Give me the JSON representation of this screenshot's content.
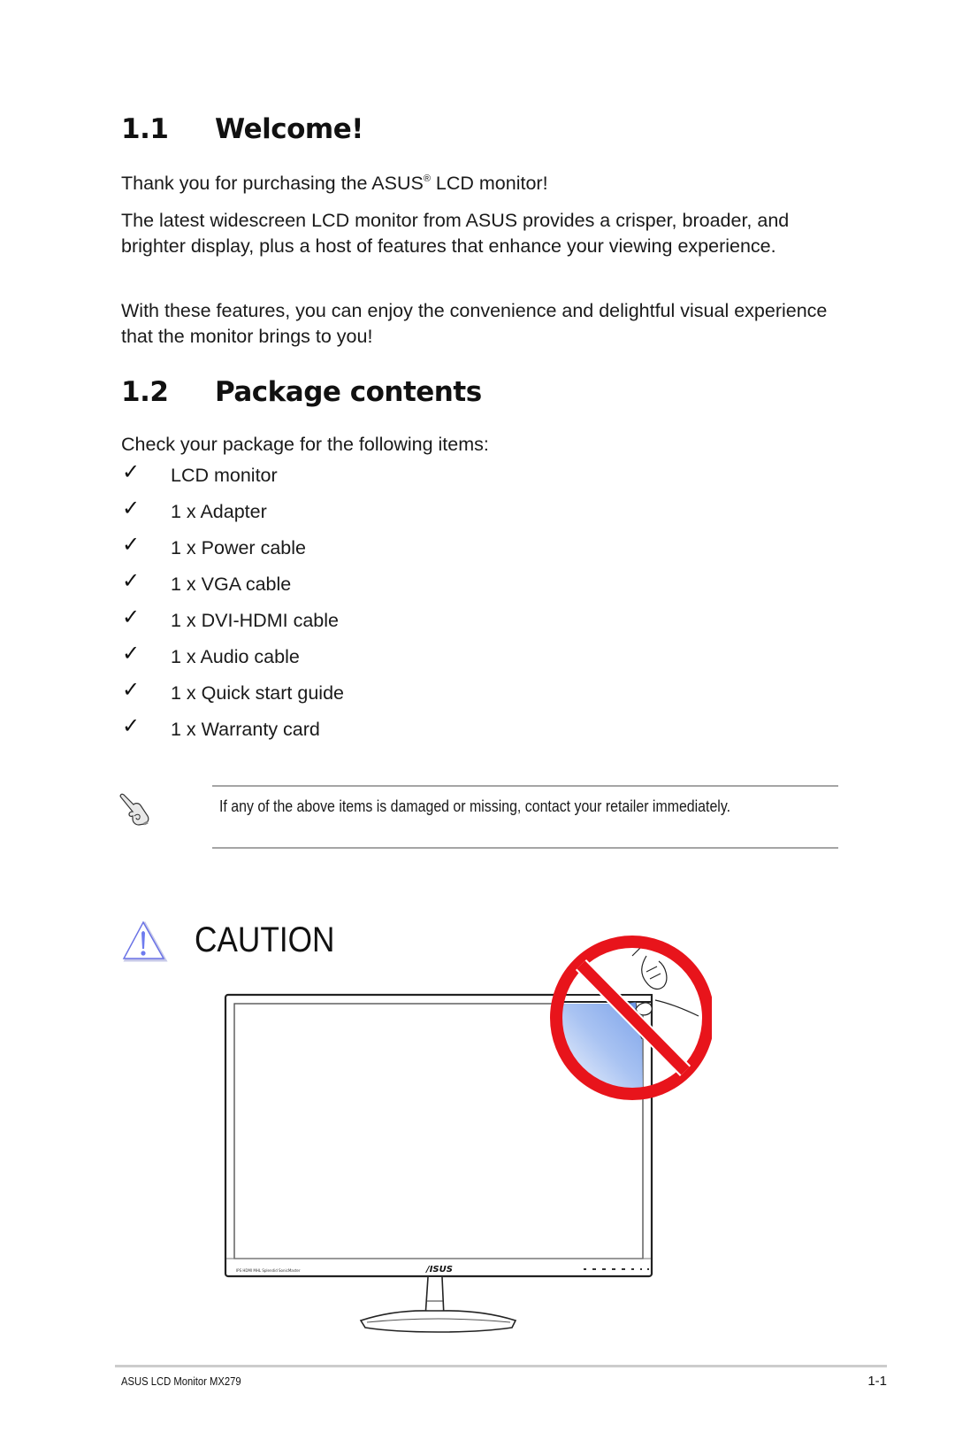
{
  "sections": [
    {
      "number": "1.1",
      "title": "Welcome!",
      "paragraphs": {
        "intro_before": "Thank you for purchasing the ASUS",
        "intro_reg": "®",
        "intro_after": " LCD monitor!",
        "p2": "The latest widescreen LCD monitor from ASUS provides a crisper, broader, and brighter display, plus a host of features that enhance your viewing experience.",
        "p3": "With these features, you can enjoy the convenience and delightful visual experience that the monitor brings to you!"
      }
    },
    {
      "number": "1.2",
      "title": "Package contents",
      "intro": "Check your package for the following items:",
      "check_glyph": "✓",
      "items": [
        "LCD monitor",
        "1 x Adapter",
        "1 x Power cable",
        "1 x VGA cable",
        "1 x DVI-HDMI cable",
        "1 x Audio cable",
        "1 x Quick start guide",
        "1 x Warranty card"
      ]
    }
  ],
  "note": {
    "icon": "pointing-hand-icon",
    "text": "If any of the above items is damaged or missing, contact your retailer immediately."
  },
  "caution": {
    "icon": "warning-triangle-icon",
    "label": "CAUTION",
    "illustration": {
      "description": "Do not peel off protective film from the monitor screen",
      "monitor_logo": "/ISUS",
      "prohibition_color": "#e8141b",
      "film_color": "#8fb3ef"
    }
  },
  "footer": {
    "product": "ASUS LCD Monitor MX279",
    "page": "1-1"
  }
}
